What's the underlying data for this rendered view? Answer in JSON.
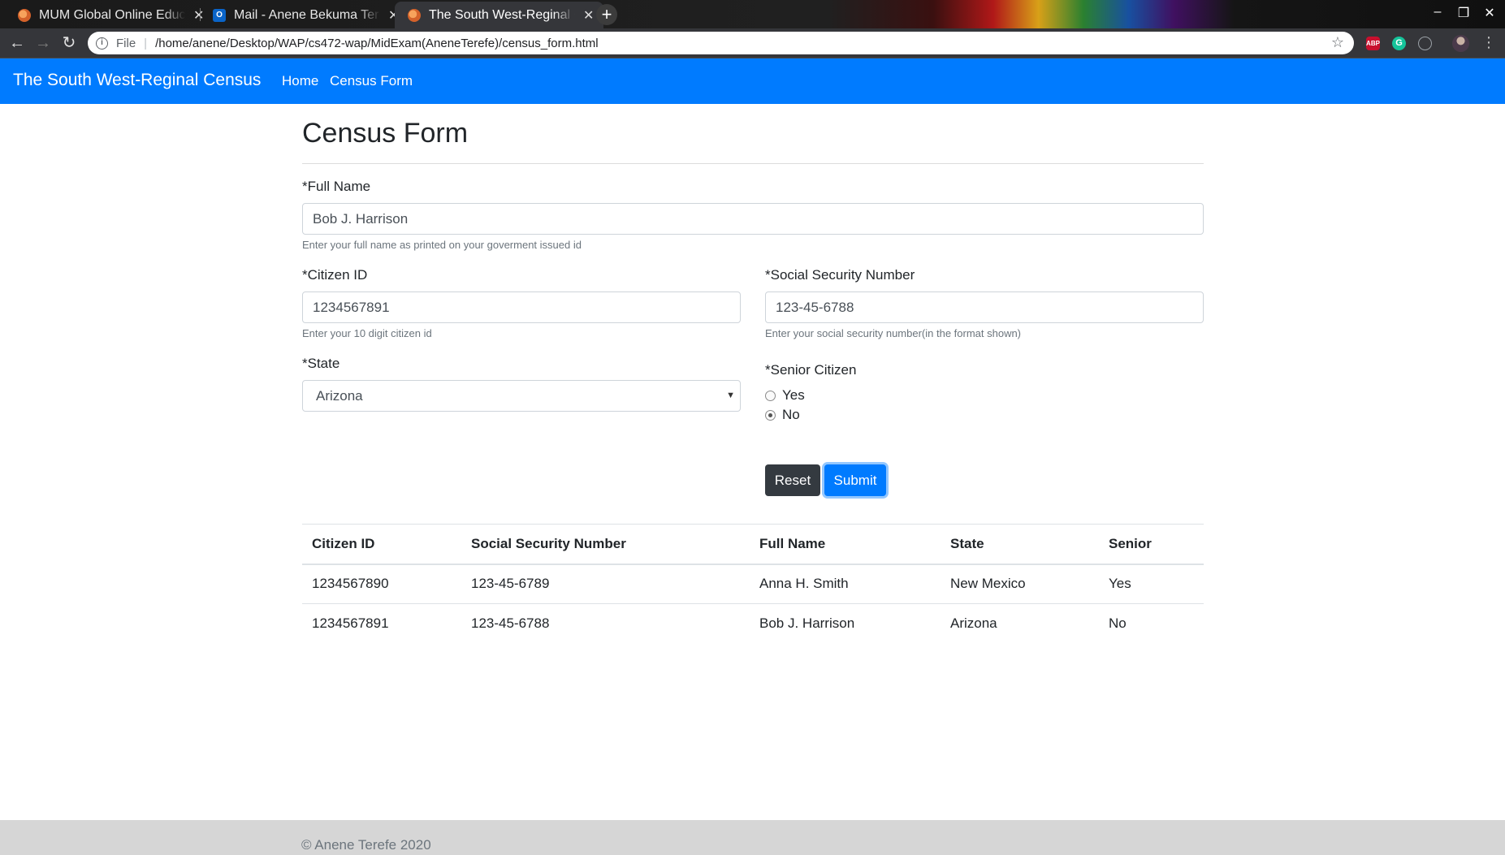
{
  "browser": {
    "tabs": [
      {
        "title": "MUM Global Online Education",
        "active": false
      },
      {
        "title": "Mail - Anene Bekuma Terefe",
        "active": false
      },
      {
        "title": "The South West-Reginal Census",
        "active": true
      }
    ],
    "new_tab_label": "+",
    "url_scheme": "File",
    "url": "/home/anene/Desktop/WAP/cs472-wap/MidExam(AneneTerefe)/census_form.html",
    "extensions": [
      "ABP",
      "G"
    ]
  },
  "navbar": {
    "brand": "The South West-Reginal Census",
    "links": [
      "Home",
      "Census Form"
    ]
  },
  "form": {
    "title": "Census Form",
    "full_name": {
      "label": "*Full Name",
      "value": "Bob J. Harrison",
      "help": "Enter your full name as printed on your goverment issued id"
    },
    "citizen_id": {
      "label": "*Citizen ID",
      "value": "1234567891",
      "help": "Enter your 10 digit citizen id"
    },
    "ssn": {
      "label": "*Social Security Number",
      "value": "123-45-6788",
      "help": "Enter your social security number(in the format shown)"
    },
    "state": {
      "label": "*State",
      "value": "Arizona"
    },
    "senior": {
      "label": "*Senior Citizen",
      "options": [
        "Yes",
        "No"
      ],
      "selected": "No"
    },
    "reset_label": "Reset",
    "submit_label": "Submit"
  },
  "table": {
    "headers": [
      "Citizen ID",
      "Social Security Number",
      "Full Name",
      "State",
      "Senior"
    ],
    "rows": [
      [
        "1234567890",
        "123-45-6789",
        "Anna H. Smith",
        "New Mexico",
        "Yes"
      ],
      [
        "1234567891",
        "123-45-6788",
        "Bob J. Harrison",
        "Arizona",
        "No"
      ]
    ]
  },
  "footer": {
    "text": "© Anene Terefe 2020"
  }
}
